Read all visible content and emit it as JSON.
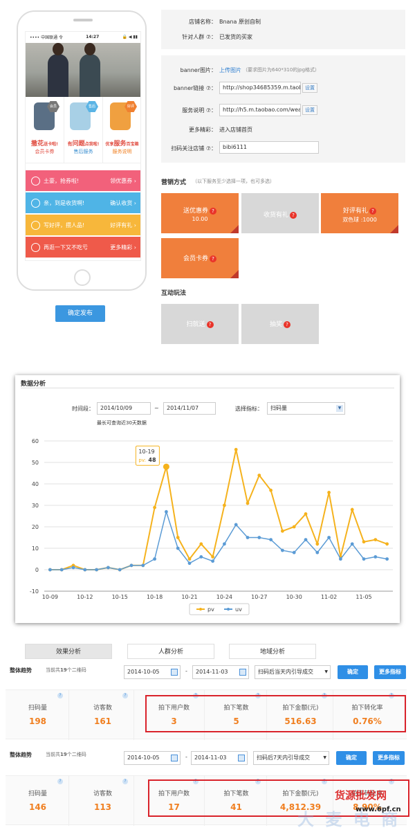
{
  "phone": {
    "status": {
      "carrier": "•••• 中国联通 令",
      "time": "14:27",
      "right": "🔒 ◀ ▮▮"
    },
    "cards": [
      {
        "badge": "会员",
        "title": "撒花",
        "title_small": "送卡啦!",
        "sub": "会员卡券"
      },
      {
        "badge": "售后",
        "title_pre": "有",
        "title": "问题",
        "title_small": "点我啦!",
        "sub": "售后服务"
      },
      {
        "badge": "好评",
        "title_pre": "优享",
        "title": "服务",
        "title_small": "百宝箱",
        "sub": "服务说明"
      }
    ],
    "strips": [
      {
        "icon": "yen-icon",
        "text": "土豪，抢券啦!",
        "action": "领优惠券",
        "color": "#f2617b"
      },
      {
        "icon": "check-icon",
        "text": "亲，到是收货啊!",
        "action": "确认收货",
        "color": "#4fb4e6"
      },
      {
        "icon": "pencil-icon",
        "text": "写好评，攒人品!",
        "action": "好评有礼",
        "color": "#f7b73b"
      },
      {
        "icon": "more-icon",
        "text": "再逛一下又不吃亏",
        "action": "更多精彩",
        "color": "#ef5a4a"
      }
    ],
    "publish": "确定发布"
  },
  "info": {
    "store_label": "店铺名称：",
    "store_value": "Bnana 原创自制",
    "crowd_label": "针对人群 ⑦：",
    "crowd_value": "已发货的买家"
  },
  "form": {
    "banner_img_label": "banner图片：",
    "banner_img_link": "上传图片",
    "banner_img_hint": "（要求图片为640*310的jpg格式）",
    "banner_link_label": "banner链接 ⑦：",
    "banner_link_value": "http://shop34685359.m.taob",
    "service_label": "服务说明 ⑦：",
    "service_value": "http://h5.m.taobao.com/weap",
    "set_label": "设置",
    "more_label": "更多精彩：",
    "more_value": "进入店铺首页",
    "scan_label": "扫码关注店铺 ⑦：",
    "scan_value": "bibi6111"
  },
  "marketing": {
    "title": "营销方式",
    "hint": "（以下服务至少选择一项，也可多选）",
    "tiles": [
      {
        "label": "送优惠券",
        "sub": "10.00",
        "active": true
      },
      {
        "label": "收货有礼",
        "sub": "",
        "active": false
      },
      {
        "label": "好评有礼",
        "sub": "双色球 :1000",
        "active": true
      },
      {
        "label": "会员卡券",
        "sub": "",
        "active": true
      }
    ]
  },
  "interactive": {
    "title": "互动玩法",
    "tiles": [
      {
        "label": "扫就送",
        "active": false
      },
      {
        "label": "抽奖",
        "active": false
      }
    ]
  },
  "analysis": {
    "title": "数据分析",
    "period_label": "时间段：",
    "start": "2014/10/09",
    "sep": "~",
    "end": "2014/11/07",
    "metric_label": "选择指标：",
    "metric_value": "扫码量",
    "note": "最长可查询近30天数据",
    "tooltip": {
      "date": "10-19",
      "series": "pv:",
      "value": "48"
    }
  },
  "chart_data": {
    "type": "line",
    "x": [
      "10-09",
      "10-10",
      "10-11",
      "10-12",
      "10-13",
      "10-14",
      "10-15",
      "10-16",
      "10-17",
      "10-18",
      "10-19",
      "10-20",
      "10-21",
      "10-22",
      "10-23",
      "10-24",
      "10-25",
      "10-26",
      "10-27",
      "10-28",
      "10-29",
      "10-30",
      "10-31",
      "11-01",
      "11-02",
      "11-03",
      "11-04",
      "11-05",
      "11-06",
      "11-07"
    ],
    "xticks": [
      "10-09",
      "10-12",
      "10-15",
      "10-18",
      "10-21",
      "10-24",
      "10-27",
      "10-30",
      "11-02",
      "11-05"
    ],
    "ylim": [
      -10,
      60
    ],
    "yticks": [
      -10,
      0,
      10,
      20,
      30,
      40,
      50,
      60
    ],
    "series": [
      {
        "name": "pv",
        "color": "#f5b21d",
        "values": [
          0,
          0,
          2,
          0,
          0,
          1,
          0,
          2,
          2,
          29,
          48,
          15,
          5,
          12,
          6,
          30,
          56,
          31,
          44,
          37,
          18,
          20,
          26,
          12,
          36,
          6,
          28,
          13,
          14,
          12
        ]
      },
      {
        "name": "uv",
        "color": "#5b9bd5",
        "values": [
          0,
          0,
          1,
          0,
          0,
          1,
          0,
          2,
          2,
          5,
          27,
          10,
          3,
          6,
          4,
          12,
          21,
          15,
          15,
          14,
          9,
          8,
          14,
          8,
          15,
          5,
          12,
          5,
          6,
          5
        ]
      }
    ]
  },
  "tabs": [
    "效果分析",
    "人群分析",
    "地域分析"
  ],
  "trend1": {
    "label": "整体趋势",
    "count_pre": "当前共",
    "count": "19",
    "count_post": "个二维码",
    "start": "2014-10-05",
    "dash": "-",
    "end": "2014-11-03",
    "filter": "扫码后当天内引导成交",
    "confirm": "确定",
    "more": "更多指标",
    "metrics": [
      {
        "name": "扫码量",
        "value": "198"
      },
      {
        "name": "访客数",
        "value": "161"
      },
      {
        "name": "拍下用户数",
        "value": "3"
      },
      {
        "name": "拍下笔数",
        "value": "5"
      },
      {
        "name": "拍下金额(元)",
        "value": "516.63"
      },
      {
        "name": "拍下转化率",
        "value": "0.76%"
      }
    ]
  },
  "trend2": {
    "label": "整体趋势",
    "count_pre": "当前共",
    "count": "19",
    "count_post": "个二维码",
    "start": "2014-10-05",
    "dash": "-",
    "end": "2014-11-03",
    "filter": "扫码后7天内引导成交",
    "confirm": "确定",
    "more": "更多指标",
    "metrics": [
      {
        "name": "扫码量",
        "value": "146"
      },
      {
        "name": "访客数",
        "value": "113"
      },
      {
        "name": "拍下用户数",
        "value": "17"
      },
      {
        "name": "拍下笔数",
        "value": "41"
      },
      {
        "name": "拍下金额(元)",
        "value": "4,812.39"
      },
      {
        "name": "拍下转化率",
        "value": "8.90%"
      }
    ]
  },
  "watermark": {
    "line1": "货源批发网",
    "line2": "www.6pf.cn",
    "line3": "大 麦 电 商"
  }
}
